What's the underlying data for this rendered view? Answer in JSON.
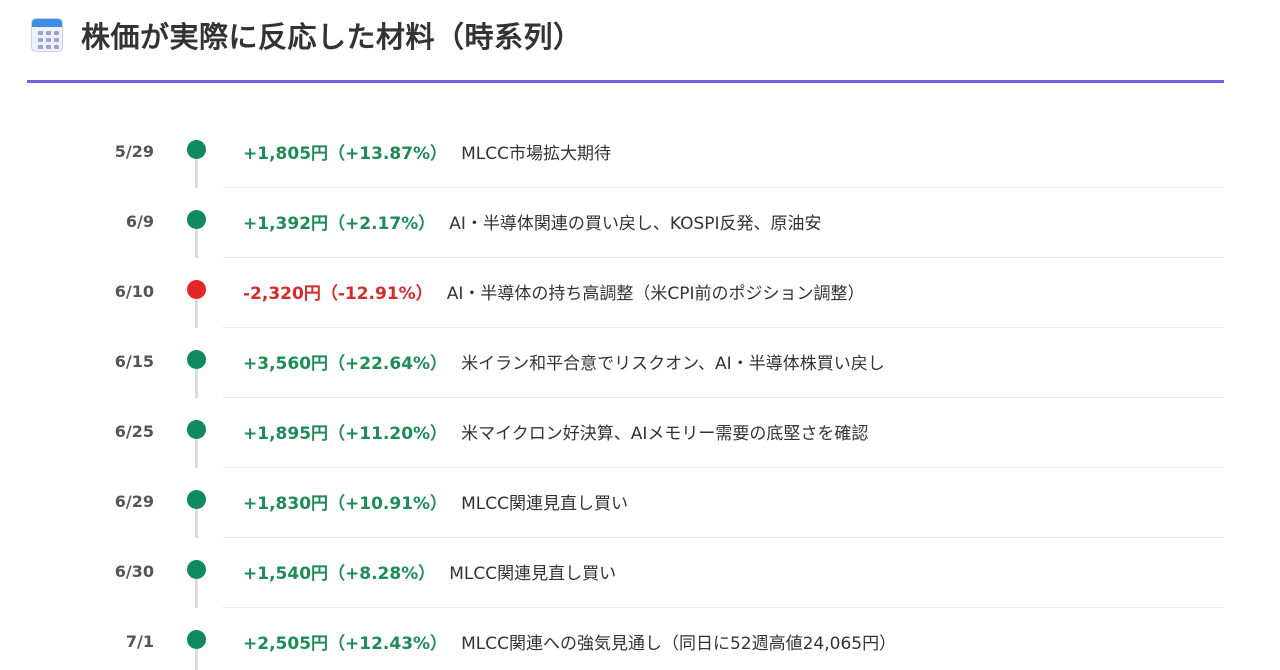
{
  "header": {
    "icon": "calendar-icon",
    "title": "株価が実際に反応した材料（時系列）"
  },
  "colors": {
    "accent_rule": "#6b63e0",
    "up": "#1e8c56",
    "down": "#d42a2a"
  },
  "events": [
    {
      "date": "5/29",
      "direction": "up",
      "change": "+1,805円（+13.87%）",
      "note": "MLCC市場拡大期待"
    },
    {
      "date": "6/9",
      "direction": "up",
      "change": "+1,392円（+2.17%）",
      "note": "AI・半導体関連の買い戻し、KOSPI反発、原油安"
    },
    {
      "date": "6/10",
      "direction": "down",
      "change": "-2,320円（-12.91%）",
      "note": "AI・半導体の持ち高調整（米CPI前のポジション調整）"
    },
    {
      "date": "6/15",
      "direction": "up",
      "change": "+3,560円（+22.64%）",
      "note": "米イラン和平合意でリスクオン、AI・半導体株買い戻し"
    },
    {
      "date": "6/25",
      "direction": "up",
      "change": "+1,895円（+11.20%）",
      "note": "米マイクロン好決算、AIメモリー需要の底堅さを確認"
    },
    {
      "date": "6/29",
      "direction": "up",
      "change": "+1,830円（+10.91%）",
      "note": "MLCC関連見直し買い"
    },
    {
      "date": "6/30",
      "direction": "up",
      "change": "+1,540円（+8.28%）",
      "note": "MLCC関連見直し買い"
    },
    {
      "date": "7/1",
      "direction": "up",
      "change": "+2,505円（+12.43%）",
      "note": "MLCC関連への強気見通し（同日に52週高値24,065円）"
    }
  ]
}
